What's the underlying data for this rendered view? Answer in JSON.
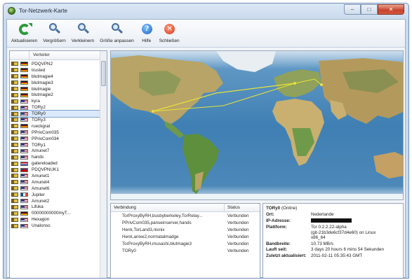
{
  "window": {
    "title": "Tor-Netzwerk-Karte",
    "controls": [
      "–",
      "□",
      "✕"
    ]
  },
  "toolbar": [
    {
      "label": "Aktualisieren",
      "icon": "refresh-icon"
    },
    {
      "label": "Vergrößern",
      "icon": "zoom-in-icon"
    },
    {
      "label": "Verkleinern",
      "icon": "zoom-out-icon"
    },
    {
      "label": "Größe anpassen",
      "icon": "zoom-fit-icon"
    },
    {
      "label": "Hilfe",
      "icon": "help-icon"
    },
    {
      "label": "Schließen",
      "icon": "close-icon"
    }
  ],
  "relay_list": {
    "column_header": "Verteiler",
    "selected": "TORy0",
    "items": [
      {
        "name": "PDQVPN2",
        "flag": "de"
      },
      {
        "name": "trusted",
        "flag": "de"
      },
      {
        "name": "blutmagie4",
        "flag": "de"
      },
      {
        "name": "blutmagie3",
        "flag": "de"
      },
      {
        "name": "blutmagie",
        "flag": "de"
      },
      {
        "name": "blutmagie2",
        "flag": "de"
      },
      {
        "name": "kyra",
        "flag": "us"
      },
      {
        "name": "TORy2",
        "flag": "us"
      },
      {
        "name": "TORy0",
        "flag": "us"
      },
      {
        "name": "TORy3",
        "flag": "us"
      },
      {
        "name": "rueckgrat",
        "flag": "de"
      },
      {
        "name": "PPrivCom035",
        "flag": "us"
      },
      {
        "name": "PPrivCom034",
        "flag": "us"
      },
      {
        "name": "TORy1",
        "flag": "us"
      },
      {
        "name": "Amunet7",
        "flag": "us"
      },
      {
        "name": "hands",
        "flag": "us"
      },
      {
        "name": "gatereloaded",
        "flag": "nl"
      },
      {
        "name": "PDQVPNUK1",
        "flag": "gb"
      },
      {
        "name": "Amunet1",
        "flag": "us"
      },
      {
        "name": "Amunet4",
        "flag": "us"
      },
      {
        "name": "Amunet6",
        "flag": "us"
      },
      {
        "name": "Jupiter",
        "flag": "fr"
      },
      {
        "name": "Amunet2",
        "flag": "us"
      },
      {
        "name": "Lifuka",
        "flag": "us"
      },
      {
        "name": "00000000000myT...",
        "flag": "de"
      },
      {
        "name": "Hexagon",
        "flag": "us"
      },
      {
        "name": "Unalonso",
        "flag": "us"
      }
    ]
  },
  "connections": {
    "headers": {
      "connection": "Verbindung",
      "status": "Status"
    },
    "rows": [
      {
        "path": "TorProxyByRH,busbyberkeley,TorRelay...",
        "status": "Verbunden"
      },
      {
        "path": "PPrivCom035,panseinserver,hands",
        "status": "Verbunden"
      },
      {
        "path": "Henk,TorLand3,nixnix",
        "status": "Verbunden"
      },
      {
        "path": "Henk,anixe2,normatalmadge",
        "status": "Verbunden"
      },
      {
        "path": "TorProxyByRH,musashi,blutmagie3",
        "status": "Verbunden"
      },
      {
        "path": "TORy0",
        "status": "Verbunden"
      }
    ]
  },
  "relay_info": {
    "name": "TORy0",
    "state": "(Online)",
    "rows": [
      {
        "label": "Ort:",
        "value": "Nederlande"
      },
      {
        "label": "IP-Adresse:",
        "value": "",
        "redacted": true
      },
      {
        "label": "Plattform:",
        "value": "Tor 0.2.2.22-alpha\n(git-21b3de6cf37d4e60) on Linux\nx86_64"
      },
      {
        "label": "Bandbreite:",
        "value": "10.73 MB/s"
      },
      {
        "label": "Lauft seit:",
        "value": "3 days 20 hours 6 mins 54 Sekunden"
      },
      {
        "label": "Zuletzt aktualisiert:",
        "value": "2011-02-11 05:35:43 GMT"
      }
    ]
  },
  "map": {
    "ocean_color": "#3f7fb3",
    "land_color": "#b4a06a",
    "route_color": "#e8e23a"
  }
}
